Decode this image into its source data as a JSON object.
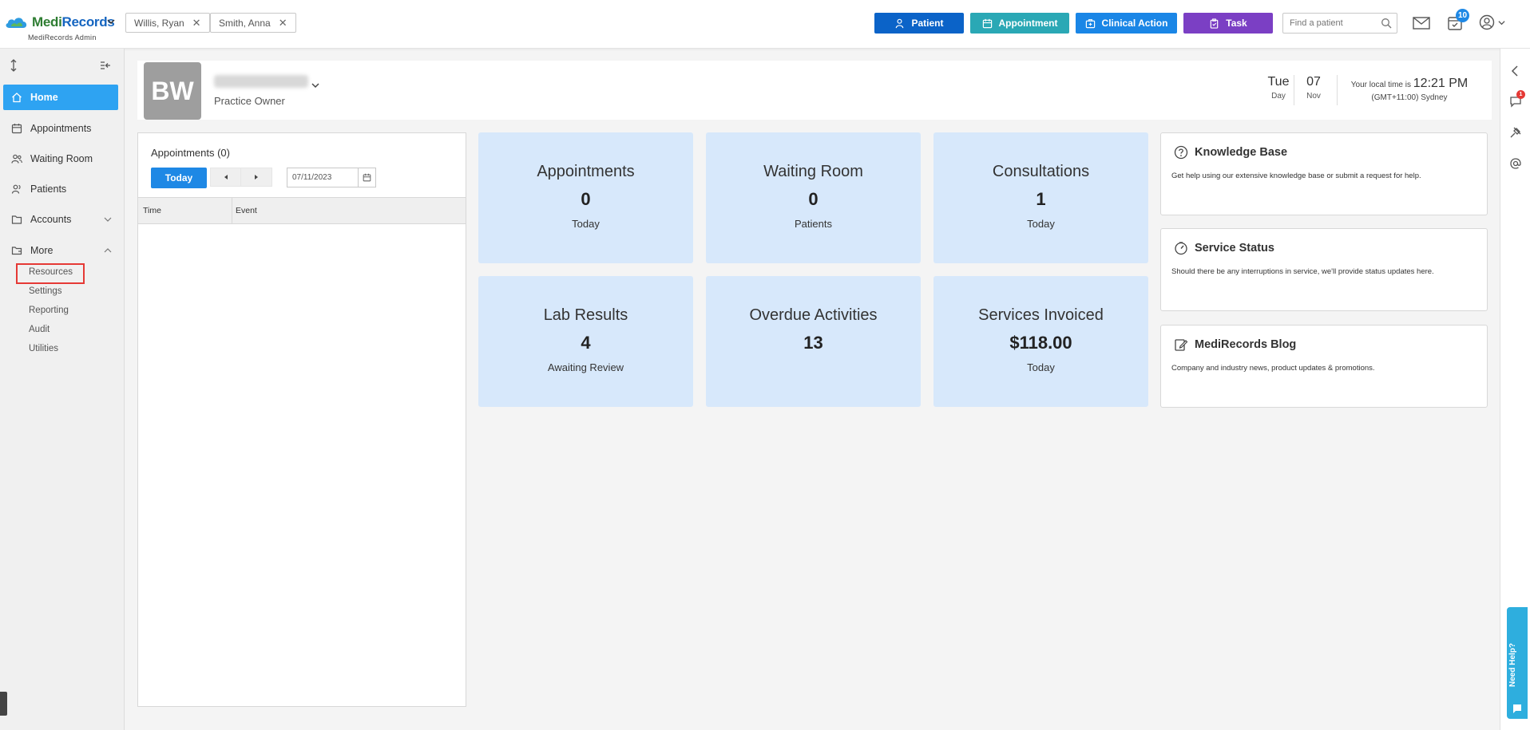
{
  "app": {
    "logo_part1": "Medi",
    "logo_part2": "Records",
    "logo_subtitle": "MediRecords Admin"
  },
  "open_patients": [
    {
      "name": "Willis, Ryan"
    },
    {
      "name": "Smith, Anna"
    }
  ],
  "actions": {
    "patient": "Patient",
    "appointment": "Appointment",
    "clinical_action": "Clinical Action",
    "task": "Task"
  },
  "colors": {
    "patient": "#0b63c8",
    "appointment": "#2aa8b5",
    "clinical_action": "#1a86e6",
    "task": "#7b3fc4",
    "active_nav": "#2ea3f2",
    "card_bg": "#d7e8fb"
  },
  "search": {
    "placeholder": "Find a patient"
  },
  "notifications": {
    "task_count": "10",
    "rail_badge": "1"
  },
  "sidebar": {
    "items": [
      {
        "label": "Home"
      },
      {
        "label": "Appointments"
      },
      {
        "label": "Waiting Room"
      },
      {
        "label": "Patients"
      },
      {
        "label": "Accounts"
      },
      {
        "label": "More"
      }
    ],
    "more_items": [
      {
        "label": "Resources"
      },
      {
        "label": "Settings"
      },
      {
        "label": "Reporting"
      },
      {
        "label": "Audit"
      },
      {
        "label": "Utilities"
      }
    ]
  },
  "user": {
    "initials": "BW",
    "role": "Practice Owner"
  },
  "date": {
    "weekday": "Tue",
    "weekday_sub": "Day",
    "day": "07",
    "month": "Nov"
  },
  "time": {
    "prefix": "Your local time is",
    "value": "12:21 PM",
    "timezone": "(GMT+11:00) Sydney"
  },
  "appointments_panel": {
    "title": "Appointments (0)",
    "today_label": "Today",
    "date_value": "07/11/2023",
    "col_time": "Time",
    "col_event": "Event"
  },
  "cards": [
    {
      "title": "Appointments",
      "value": "0",
      "sub": "Today"
    },
    {
      "title": "Waiting Room",
      "value": "0",
      "sub": "Patients"
    },
    {
      "title": "Consultations",
      "value": "1",
      "sub": "Today"
    },
    {
      "title": "Lab Results",
      "value": "4",
      "sub": "Awaiting Review"
    },
    {
      "title": "Overdue Activities",
      "value": "13",
      "sub": ""
    },
    {
      "title": "Services Invoiced",
      "value": "$118.00",
      "sub": "Today"
    }
  ],
  "info_panels": [
    {
      "title": "Knowledge Base",
      "body": "Get help using our extensive knowledge base or submit a request for help."
    },
    {
      "title": "Service Status",
      "body": "Should there be any interruptions in service, we'll provide status updates here."
    },
    {
      "title": "MediRecords Blog",
      "body": "Company and industry news, product updates & promotions."
    }
  ],
  "help": {
    "label": "Need Help?"
  }
}
